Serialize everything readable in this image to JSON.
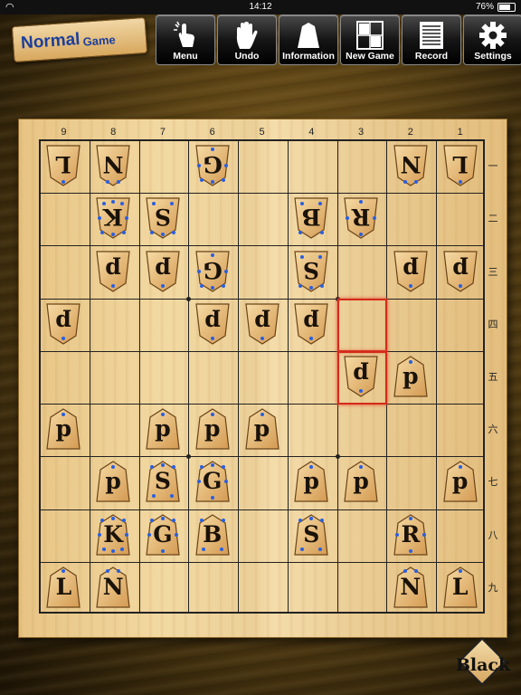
{
  "status_bar": {
    "time": "14:12",
    "battery": "76%",
    "battery_level": 0.76
  },
  "mode": {
    "main": "Normal",
    "sub": "Game"
  },
  "toolbar": [
    {
      "id": "menu",
      "label": "Menu",
      "icon": "tap-finger-icon"
    },
    {
      "id": "undo",
      "label": "Undo",
      "icon": "hand-icon"
    },
    {
      "id": "information",
      "label": "Information",
      "icon": "piece-icon"
    },
    {
      "id": "new-game",
      "label": "New Game",
      "icon": "board-icon"
    },
    {
      "id": "record",
      "label": "Record",
      "icon": "list-icon"
    },
    {
      "id": "settings",
      "label": "Settings",
      "icon": "gear-icon"
    }
  ],
  "board": {
    "files": [
      "9",
      "8",
      "7",
      "6",
      "5",
      "4",
      "3",
      "2",
      "1"
    ],
    "ranks": [
      "一",
      "二",
      "三",
      "四",
      "五",
      "六",
      "七",
      "八",
      "九"
    ],
    "highlight_squares": [
      [
        3,
        4
      ],
      [
        3,
        5
      ]
    ],
    "pieces": [
      {
        "f": 9,
        "r": 1,
        "t": "L",
        "o": "gote"
      },
      {
        "f": 8,
        "r": 1,
        "t": "N",
        "o": "gote"
      },
      {
        "f": 6,
        "r": 1,
        "t": "G",
        "o": "gote"
      },
      {
        "f": 2,
        "r": 1,
        "t": "N",
        "o": "gote"
      },
      {
        "f": 1,
        "r": 1,
        "t": "L",
        "o": "gote"
      },
      {
        "f": 8,
        "r": 2,
        "t": "K",
        "o": "gote"
      },
      {
        "f": 7,
        "r": 2,
        "t": "S",
        "o": "gote"
      },
      {
        "f": 4,
        "r": 2,
        "t": "B",
        "o": "gote"
      },
      {
        "f": 3,
        "r": 2,
        "t": "R",
        "o": "gote"
      },
      {
        "f": 8,
        "r": 3,
        "t": "p",
        "o": "gote"
      },
      {
        "f": 7,
        "r": 3,
        "t": "p",
        "o": "gote"
      },
      {
        "f": 6,
        "r": 3,
        "t": "G",
        "o": "gote"
      },
      {
        "f": 4,
        "r": 3,
        "t": "S",
        "o": "gote"
      },
      {
        "f": 2,
        "r": 3,
        "t": "p",
        "o": "gote"
      },
      {
        "f": 1,
        "r": 3,
        "t": "p",
        "o": "gote"
      },
      {
        "f": 9,
        "r": 4,
        "t": "p",
        "o": "gote"
      },
      {
        "f": 6,
        "r": 4,
        "t": "p",
        "o": "gote"
      },
      {
        "f": 5,
        "r": 4,
        "t": "p",
        "o": "gote"
      },
      {
        "f": 4,
        "r": 4,
        "t": "p",
        "o": "gote"
      },
      {
        "f": 3,
        "r": 5,
        "t": "p",
        "o": "gote"
      },
      {
        "f": 2,
        "r": 5,
        "t": "p",
        "o": "sente"
      },
      {
        "f": 9,
        "r": 6,
        "t": "p",
        "o": "sente"
      },
      {
        "f": 7,
        "r": 6,
        "t": "p",
        "o": "sente"
      },
      {
        "f": 6,
        "r": 6,
        "t": "p",
        "o": "sente"
      },
      {
        "f": 5,
        "r": 6,
        "t": "p",
        "o": "sente"
      },
      {
        "f": 8,
        "r": 7,
        "t": "p",
        "o": "sente"
      },
      {
        "f": 7,
        "r": 7,
        "t": "S",
        "o": "sente"
      },
      {
        "f": 6,
        "r": 7,
        "t": "G",
        "o": "sente"
      },
      {
        "f": 4,
        "r": 7,
        "t": "p",
        "o": "sente"
      },
      {
        "f": 3,
        "r": 7,
        "t": "p",
        "o": "sente"
      },
      {
        "f": 1,
        "r": 7,
        "t": "p",
        "o": "sente"
      },
      {
        "f": 8,
        "r": 8,
        "t": "K",
        "o": "sente"
      },
      {
        "f": 7,
        "r": 8,
        "t": "G",
        "o": "sente"
      },
      {
        "f": 6,
        "r": 8,
        "t": "B",
        "o": "sente"
      },
      {
        "f": 4,
        "r": 8,
        "t": "S",
        "o": "sente"
      },
      {
        "f": 2,
        "r": 8,
        "t": "R",
        "o": "sente"
      },
      {
        "f": 9,
        "r": 9,
        "t": "L",
        "o": "sente"
      },
      {
        "f": 8,
        "r": 9,
        "t": "N",
        "o": "sente"
      },
      {
        "f": 2,
        "r": 9,
        "t": "N",
        "o": "sente"
      },
      {
        "f": 1,
        "r": 9,
        "t": "L",
        "o": "sente"
      }
    ]
  },
  "turn": {
    "label": "Black"
  },
  "colors": {
    "highlight": "#d42b1b",
    "move_dot": "#2a5fe0",
    "mode_text": "#1c3f9c"
  }
}
